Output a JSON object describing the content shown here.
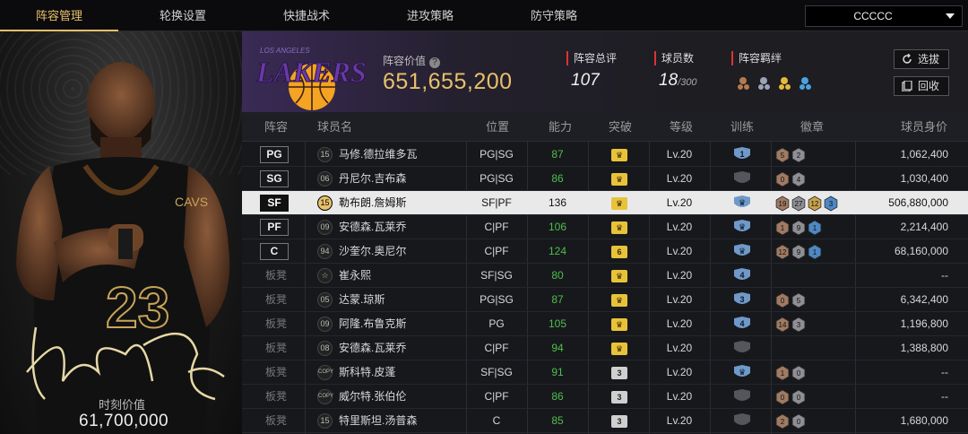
{
  "nav": {
    "tabs": [
      "阵容管理",
      "轮换设置",
      "快捷战术",
      "进攻策略",
      "防守策略"
    ],
    "active_tab": 0,
    "dropdown_value": "CCCCC"
  },
  "player_panel": {
    "jersey_number": "23",
    "value_label": "时刻价值",
    "value": "61,700,000"
  },
  "team": {
    "logo_text": "LAKERS",
    "logo_subtext": "LOS ANGELES",
    "value_label": "阵容价值",
    "value": "651,655,200",
    "overall_label": "阵容总评",
    "overall": "107",
    "players_label": "球员数",
    "players_count": "18",
    "players_max": "/300",
    "bond_label": "阵容羁绊",
    "select_button": "选拔",
    "recycle_button": "回收"
  },
  "colors": {
    "accent": "#e8c06a",
    "green": "#4fbf4b",
    "lakers_purple": "#552583",
    "lakers_gold": "#fdb927"
  },
  "table": {
    "headers": [
      "阵容",
      "球员名",
      "位置",
      "能力",
      "突破",
      "等级",
      "训练",
      "徽章",
      "球员身价"
    ],
    "rows": [
      {
        "slot": "PG",
        "bench": false,
        "num": "15",
        "name": "马修.德拉维多瓦",
        "pos": "PG|SG",
        "ability": "87",
        "ability_green": true,
        "break": "♛",
        "break_gray": false,
        "level": "Lv.20",
        "train": "1",
        "train_type": "num",
        "badges": [
          "5",
          "2"
        ],
        "badge_kinds": [
          "bronze",
          "silver"
        ],
        "price": "1,062,400"
      },
      {
        "slot": "SG",
        "bench": false,
        "num": "06",
        "name": "丹尼尔.吉布森",
        "pos": "PG|SG",
        "ability": "86",
        "ability_green": true,
        "break": "♛",
        "break_gray": false,
        "level": "Lv.20",
        "train": "",
        "train_type": "none",
        "badges": [
          "0",
          "4"
        ],
        "badge_kinds": [
          "bronze",
          "silver"
        ],
        "price": "1,030,400"
      },
      {
        "slot": "SF",
        "bench": false,
        "num": "15",
        "name": "勒布朗.詹姆斯",
        "pos": "SF|PF",
        "ability": "136",
        "ability_green": false,
        "break": "♛",
        "break_gray": false,
        "level": "Lv.20",
        "train": "",
        "train_type": "crown",
        "badges": [
          "19",
          "27",
          "12",
          "3"
        ],
        "badge_kinds": [
          "bronze",
          "silver",
          "gold",
          "blue"
        ],
        "price": "506,880,000",
        "highlight": true
      },
      {
        "slot": "PF",
        "bench": false,
        "num": "09",
        "name": "安德森.瓦莱乔",
        "pos": "C|PF",
        "ability": "106",
        "ability_green": true,
        "break": "♛",
        "break_gray": false,
        "level": "Lv.20",
        "train": "",
        "train_type": "crown",
        "badges": [
          "1",
          "9",
          "1"
        ],
        "badge_kinds": [
          "bronze",
          "silver",
          "blue"
        ],
        "price": "2,214,400"
      },
      {
        "slot": "C",
        "bench": false,
        "num": "94",
        "name": "沙奎尔.奥尼尔",
        "pos": "C|PF",
        "ability": "124",
        "ability_green": true,
        "break": "6",
        "break_gray": false,
        "level": "Lv.20",
        "train": "",
        "train_type": "crown",
        "badges": [
          "12",
          "9",
          "1"
        ],
        "badge_kinds": [
          "bronze",
          "silver",
          "blue"
        ],
        "price": "68,160,000"
      },
      {
        "slot": "板凳",
        "bench": true,
        "num": "☆",
        "name": "崔永熙",
        "pos": "SF|SG",
        "ability": "80",
        "ability_green": true,
        "break": "♛",
        "break_gray": false,
        "level": "Lv.20",
        "train": "4",
        "train_type": "num",
        "badges": [],
        "badge_kinds": [],
        "price": "--"
      },
      {
        "slot": "板凳",
        "bench": true,
        "num": "05",
        "name": "达蒙.琼斯",
        "pos": "PG|SG",
        "ability": "87",
        "ability_green": true,
        "break": "♛",
        "break_gray": false,
        "level": "Lv.20",
        "train": "3",
        "train_type": "num",
        "badges": [
          "0",
          "5"
        ],
        "badge_kinds": [
          "bronze",
          "silver"
        ],
        "price": "6,342,400"
      },
      {
        "slot": "板凳",
        "bench": true,
        "num": "09",
        "name": "阿隆.布鲁克斯",
        "pos": "PG",
        "ability": "105",
        "ability_green": true,
        "break": "♛",
        "break_gray": false,
        "level": "Lv.20",
        "train": "4",
        "train_type": "num",
        "badges": [
          "14",
          "3"
        ],
        "badge_kinds": [
          "bronze",
          "silver"
        ],
        "price": "1,196,800"
      },
      {
        "slot": "板凳",
        "bench": true,
        "num": "08",
        "name": "安德森.瓦莱乔",
        "pos": "C|PF",
        "ability": "94",
        "ability_green": true,
        "break": "♛",
        "break_gray": false,
        "level": "Lv.20",
        "train": "",
        "train_type": "none",
        "badges": [],
        "badge_kinds": [],
        "price": "1,388,800"
      },
      {
        "slot": "板凳",
        "bench": true,
        "num": "COPY",
        "name": "斯科特.皮蓬",
        "pos": "SF|SG",
        "ability": "91",
        "ability_green": true,
        "break": "3",
        "break_gray": true,
        "level": "Lv.20",
        "train": "",
        "train_type": "crown",
        "badges": [
          "1",
          "0"
        ],
        "badge_kinds": [
          "bronze",
          "silver"
        ],
        "price": "--"
      },
      {
        "slot": "板凳",
        "bench": true,
        "num": "COPY",
        "name": "威尔特.张伯伦",
        "pos": "C|PF",
        "ability": "86",
        "ability_green": true,
        "break": "3",
        "break_gray": true,
        "level": "Lv.20",
        "train": "",
        "train_type": "none",
        "badges": [
          "0",
          "0"
        ],
        "badge_kinds": [
          "bronze",
          "silver"
        ],
        "price": "--"
      },
      {
        "slot": "板凳",
        "bench": true,
        "num": "15",
        "name": "特里斯坦.汤普森",
        "pos": "C",
        "ability": "85",
        "ability_green": true,
        "break": "3",
        "break_gray": true,
        "level": "Lv.20",
        "train": "",
        "train_type": "none",
        "badges": [
          "2",
          "0"
        ],
        "badge_kinds": [
          "bronze",
          "silver"
        ],
        "price": "1,680,000"
      }
    ]
  }
}
